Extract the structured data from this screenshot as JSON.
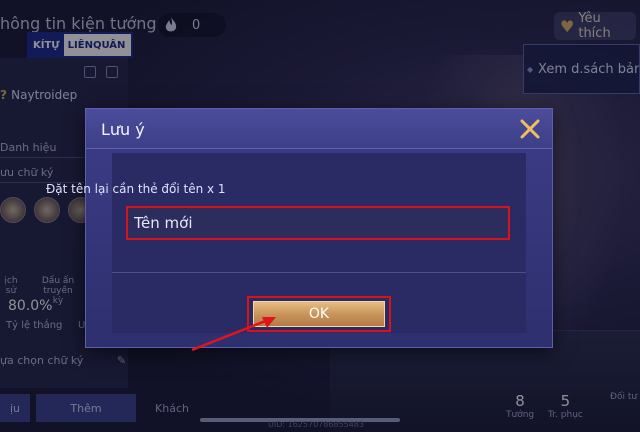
{
  "background": {
    "title": "hông tin kiện tướng",
    "fire_count": "0",
    "logo": {
      "part1": "KÍTỰ",
      "part2": "LIÊNQUÂN"
    },
    "like_label": "Yêu thích",
    "list_label": "Xem d.sách bản",
    "player_name": "Naytroidep",
    "fields": [
      "Danh hiệu",
      "ưu chữ ký"
    ],
    "stats": {
      "history_label": "ịch sử",
      "mark_label": "Dấu ấn truyền kỳ",
      "win_rate": "80.0%",
      "win_rate_label": "Tỷ lệ thắng",
      "extra_label": "U"
    },
    "signature_row": "ựa chọn chữ ký",
    "tabs": [
      "ịu",
      "Thêm",
      "Khách"
    ],
    "counts": [
      {
        "number": "8",
        "label": "Tướng"
      },
      {
        "number": "5",
        "label": "Tr. phục"
      },
      {
        "number": "",
        "label": "Đối tư"
      }
    ],
    "uid": "UID: 162570786855483"
  },
  "dialog": {
    "title": "Lưu ý",
    "rename_label": "Đặt tên lại cần thẻ đổi tên x 1",
    "name_input": {
      "value": "",
      "placeholder": "Tên mới"
    },
    "ok_label": "OK"
  },
  "colors": {
    "highlight": "#d7131a",
    "dialog_bg": "#3c3d88",
    "ok_gold": "#c7925a",
    "close_x": "#f0c060"
  },
  "icons": [
    "fire-icon",
    "heart-icon",
    "close-icon",
    "pencil-icon",
    "arrow-annotation"
  ]
}
